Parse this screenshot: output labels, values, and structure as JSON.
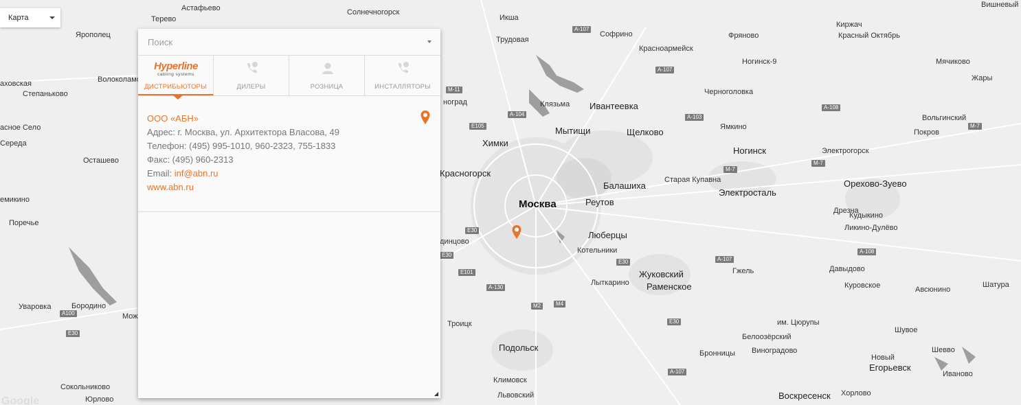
{
  "map_type": {
    "label": "Карта"
  },
  "search": {
    "placeholder": "Поиск"
  },
  "tabs": [
    {
      "label": "ДИСТРИБЬЮТОРЫ",
      "logo_text": "Hyperline",
      "logo_sub": "cabling systems"
    },
    {
      "label": "ДИЛЕРЫ"
    },
    {
      "label": "РОЗНИЦА"
    },
    {
      "label": "ИНСТАЛЛЯТОРЫ"
    }
  ],
  "entry": {
    "name": "ООО «АБН»",
    "address_label": "Адрес: ",
    "address": "г. Москва, ул. Архитектора Власова, 49",
    "phone_label": "Телефон: ",
    "phone": "(495) 995-1010, 960-2323, 755-1833",
    "fax_label": "Факс: ",
    "fax": "(495) 960-2313",
    "email_label": "Email: ",
    "email": "inf@abn.ru",
    "website": "www.abn.ru"
  },
  "colors": {
    "accent": "#e8742a"
  },
  "icons": {
    "pin": "map-pin-icon",
    "dealer": "phone-badge-icon",
    "retail": "person-icon",
    "installer": "phone-badge-icon"
  },
  "map": {
    "attribution": "Google",
    "cities": [
      {
        "name": "Москва",
        "cls": "big"
      },
      {
        "name": "Солнечногорск"
      },
      {
        "name": "Икша"
      },
      {
        "name": "Софрино"
      },
      {
        "name": "Трудовая"
      },
      {
        "name": "Красноармейск"
      },
      {
        "name": "Фряново"
      },
      {
        "name": "Киржач"
      },
      {
        "name": "Красный Октябрь"
      },
      {
        "name": "Ногинск-9"
      },
      {
        "name": "Мячиково"
      },
      {
        "name": "Жары"
      },
      {
        "name": "Черноголовка"
      },
      {
        "name": "Ивантеевка",
        "cls": "city"
      },
      {
        "name": "Мытищи",
        "cls": "city"
      },
      {
        "name": "Щелково",
        "cls": "city"
      },
      {
        "name": "Химки",
        "cls": "city"
      },
      {
        "name": "Красногорск",
        "cls": "city"
      },
      {
        "name": "Балашиха",
        "cls": "city"
      },
      {
        "name": "Реутов",
        "cls": "city"
      },
      {
        "name": "Люберцы",
        "cls": "city"
      },
      {
        "name": "Котельники"
      },
      {
        "name": "Ногинск",
        "cls": "city"
      },
      {
        "name": "Электрогорск"
      },
      {
        "name": "Старая Купавна"
      },
      {
        "name": "Электросталь",
        "cls": "city"
      },
      {
        "name": "Орехово-Зуево",
        "cls": "city"
      },
      {
        "name": "Ямкино"
      },
      {
        "name": "Вольгинский"
      },
      {
        "name": "Покров"
      },
      {
        "name": "Вишневый"
      },
      {
        "name": "Дрезна"
      },
      {
        "name": "Кудыкино"
      },
      {
        "name": "Ликино-Дулёво"
      },
      {
        "name": "Давыдово"
      },
      {
        "name": "Куровское"
      },
      {
        "name": "Авсюнино"
      },
      {
        "name": "Шатура"
      },
      {
        "name": "Гжель"
      },
      {
        "name": "Жуковский",
        "cls": "city"
      },
      {
        "name": "Раменское",
        "cls": "city"
      },
      {
        "name": "Лыткарино"
      },
      {
        "name": "Троицк"
      },
      {
        "name": "Подольск",
        "cls": "city"
      },
      {
        "name": "Климовск"
      },
      {
        "name": "Львовский"
      },
      {
        "name": "им. Цюрупы"
      },
      {
        "name": "Белоозёрский"
      },
      {
        "name": "Шувое"
      },
      {
        "name": "Бронницы"
      },
      {
        "name": "Виноградово"
      },
      {
        "name": "Новый"
      },
      {
        "name": "Егорьевск",
        "cls": "city"
      },
      {
        "name": "Шевво"
      },
      {
        "name": "Иваново"
      },
      {
        "name": "Воскресенск",
        "cls": "city"
      },
      {
        "name": "Хорлово"
      },
      {
        "name": "Астафьево"
      },
      {
        "name": "Терево"
      },
      {
        "name": "Ярополец"
      },
      {
        "name": "Волоколамск"
      },
      {
        "name": "аховская"
      },
      {
        "name": "Степаньково"
      },
      {
        "name": "асное Село"
      },
      {
        "name": "Середа"
      },
      {
        "name": "Осташево"
      },
      {
        "name": "емикино"
      },
      {
        "name": "Поречье"
      },
      {
        "name": "Уваровка"
      },
      {
        "name": "Бородино"
      },
      {
        "name": "Мож"
      },
      {
        "name": "Сокольниково"
      },
      {
        "name": "Юрлово"
      },
      {
        "name": "ноград"
      },
      {
        "name": "динцово"
      },
      {
        "name": "Клязьма"
      }
    ],
    "roads": [
      "A-107",
      "A-107",
      "A-107",
      "A-107",
      "A-108",
      "A-108",
      "M-7",
      "M-7",
      "M-7",
      "A-103",
      "A-104",
      "M-11",
      "E105",
      "E30",
      "E30",
      "E30",
      "E30",
      "E101",
      "A-130",
      "M2",
      "M4",
      "A100",
      "E30"
    ]
  }
}
